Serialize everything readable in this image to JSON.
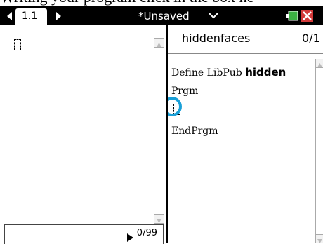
{
  "caption": "Writing your program click in the box ne",
  "titlebar": {
    "tab_label": "1.1",
    "document_title": "*Unsaved",
    "icons": {
      "prev": "arrow-left-icon",
      "next": "arrow-right-icon",
      "dropdown": "chevron-down-icon",
      "battery": "battery-icon",
      "close": "close-icon"
    },
    "colors": {
      "bar": "#000000",
      "close": "#d23a3a",
      "battery": "#3cb043"
    }
  },
  "left_pane": {
    "status": "0/99"
  },
  "editor": {
    "program_name": "hiddenfaces",
    "line_count": "0/1",
    "lines": {
      "define_prefix": "Define LibPub ",
      "define_name": "hidden",
      "prgm": "Prgm",
      "end": "EndPrgm"
    },
    "highlight_color": "#1aa0d8"
  }
}
